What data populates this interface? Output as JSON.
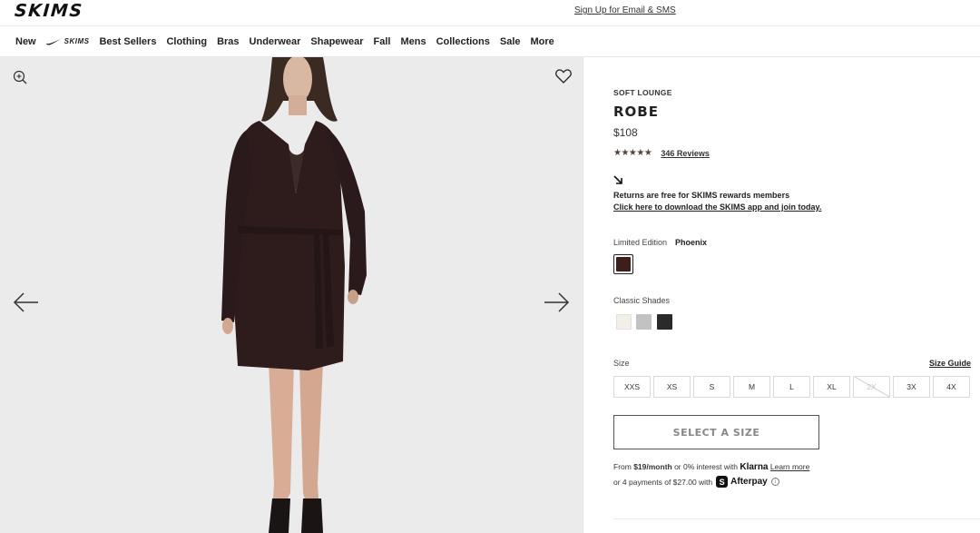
{
  "header": {
    "logo": "SKIMS",
    "signup_link": "Sign Up for Email & SMS"
  },
  "nav": {
    "items": [
      "New",
      "Best Sellers",
      "Clothing",
      "Bras",
      "Underwear",
      "Shapewear",
      "Fall",
      "Mens",
      "Collections",
      "Sale",
      "More"
    ],
    "nike_label": "SKIMS"
  },
  "gallery": {
    "icons": [
      "zoom-in-icon",
      "heart-icon",
      "arrow-left-icon",
      "arrow-right-icon"
    ]
  },
  "product": {
    "collection": "SOFT LOUNGE",
    "title": "ROBE",
    "price": "$108",
    "rating": 4.5,
    "stars": "★★★★★",
    "reviews_link": "346 Reviews",
    "returns_text": "Returns are free for SKIMS rewards members",
    "returns_link": "Click here to download the SKIMS app and join today.",
    "edition_label": "Limited Edition",
    "edition_color": "Phoenix",
    "edition_swatch": "#3d1e1c",
    "classic_label": "Classic Shades",
    "classic_swatches": [
      "#f1efe8",
      "#c2c2c2",
      "#2a2a2a"
    ],
    "size_label": "Size",
    "size_guide": "Size Guide",
    "sizes": [
      "XXS",
      "XS",
      "S",
      "M",
      "L",
      "XL",
      "2X",
      "3X",
      "4X"
    ],
    "sold_out_size": "2X",
    "select_button": "SELECT A SIZE"
  },
  "payment": {
    "klarna_prefix": "From ",
    "klarna_amount": "$19/month",
    "klarna_middle": " or 0% interest with ",
    "klarna_brand": "Klarna",
    "klarna_learn": "Learn more",
    "afterpay_text": "or 4 payments of $27.00 with",
    "afterpay_badge": "S",
    "afterpay_brand": "Afterpay",
    "info_glyph": "i"
  },
  "colors": {
    "robe": "#2e1c1d",
    "gallery_bg": "#ebebeb",
    "star": "#55443c"
  }
}
